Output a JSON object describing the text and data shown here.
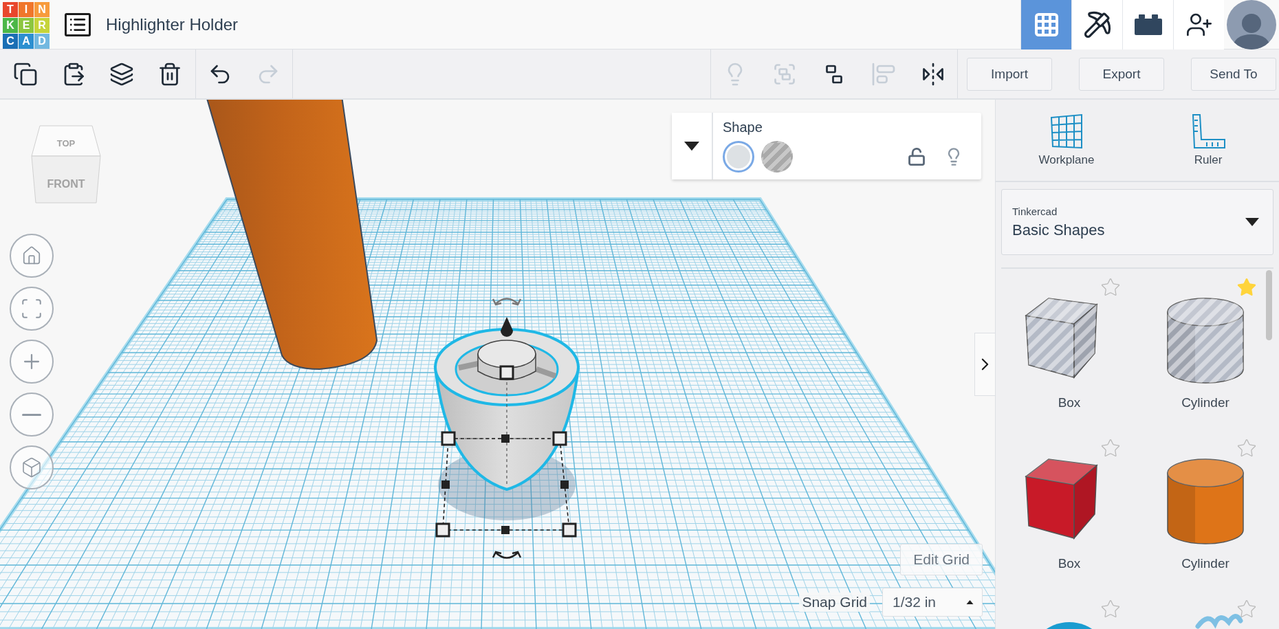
{
  "app_bar": {
    "logo": [
      {
        "letter": "T",
        "color": "#e8472d"
      },
      {
        "letter": "I",
        "color": "#f0762b"
      },
      {
        "letter": "N",
        "color": "#f79b3c"
      },
      {
        "letter": "K",
        "color": "#4cb748"
      },
      {
        "letter": "E",
        "color": "#8cc63f"
      },
      {
        "letter": "R",
        "color": "#c6d43a"
      },
      {
        "letter": "C",
        "color": "#1a6fb5"
      },
      {
        "letter": "A",
        "color": "#2c8fd0"
      },
      {
        "letter": "D",
        "color": "#72b8e0"
      }
    ],
    "title": "Highlighter Holder",
    "view_modes": [
      {
        "kind": "grid",
        "selected": true
      },
      {
        "kind": "pickaxe",
        "selected": false
      },
      {
        "kind": "bricks",
        "selected": false
      }
    ]
  },
  "toolbar": {
    "edit_tools": [
      {
        "kind": "copy",
        "disabled": false
      },
      {
        "kind": "paste",
        "disabled": false
      },
      {
        "kind": "duplicate",
        "disabled": false
      },
      {
        "kind": "delete",
        "disabled": false
      }
    ],
    "history_tools": [
      {
        "kind": "undo",
        "disabled": false
      },
      {
        "kind": "redo",
        "disabled": true
      }
    ],
    "shape_tools": [
      {
        "kind": "note",
        "disabled": true
      },
      {
        "kind": "group",
        "disabled": true
      },
      {
        "kind": "ungroup",
        "disabled": false
      },
      {
        "kind": "align",
        "disabled": true
      },
      {
        "kind": "mirror",
        "disabled": false
      }
    ],
    "buttons": [
      "Import",
      "Export",
      "Send To"
    ]
  },
  "view_cube": {
    "top": "TOP",
    "front": "FRONT"
  },
  "inspector": {
    "title": "Shape",
    "fills": [
      {
        "kind": "solid",
        "selected": true
      },
      {
        "kind": "hole",
        "selected": false
      }
    ]
  },
  "canvas": {
    "edit_grid": "Edit Grid",
    "snap_grid_label": "Snap Grid",
    "snap_grid_value": "1/32 in"
  },
  "side_panel": {
    "tools": [
      {
        "kind": "workplane",
        "label": "Workplane"
      },
      {
        "kind": "ruler",
        "label": "Ruler"
      }
    ],
    "library": {
      "provider": "Tinkercad",
      "category": "Basic Shapes"
    },
    "shapes": [
      {
        "kind": "box",
        "name": "Box",
        "hole": true,
        "starred": false,
        "color": "#b4bac6"
      },
      {
        "kind": "cylinder",
        "name": "Cylinder",
        "hole": true,
        "starred": true,
        "color": "#b4bac6"
      },
      {
        "kind": "box",
        "name": "Box",
        "hole": false,
        "starred": false,
        "color": "#c81a28"
      },
      {
        "kind": "cylinder",
        "name": "Cylinder",
        "hole": false,
        "starred": false,
        "color": "#de7418"
      },
      {
        "kind": "sphere",
        "starred": false,
        "color": "#1a9cd0"
      },
      {
        "kind": "scribble",
        "starred": false,
        "color": "#7ec0e4"
      }
    ]
  }
}
